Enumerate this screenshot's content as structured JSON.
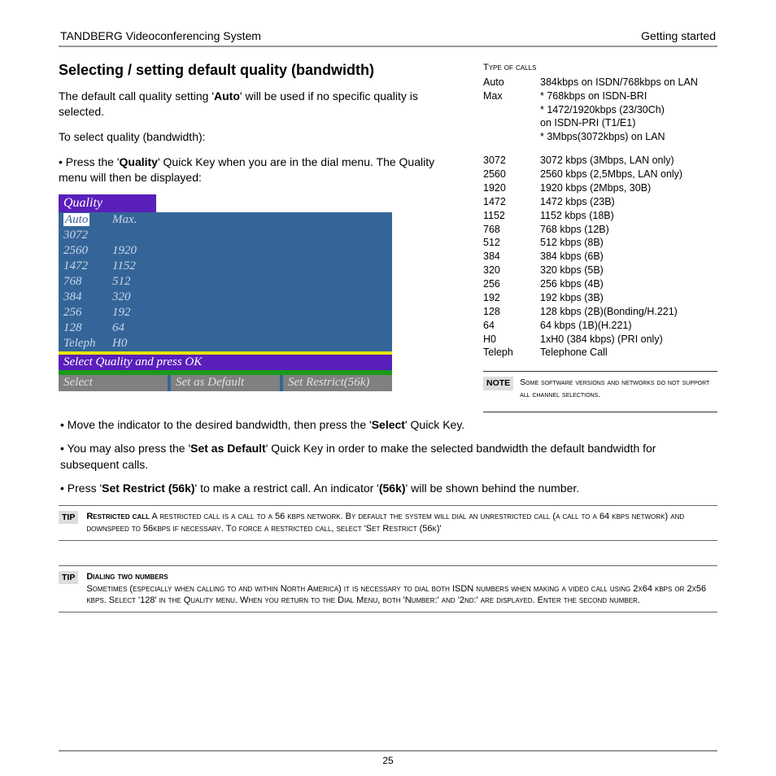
{
  "header": {
    "left": "TANDBERG Videoconferencing System",
    "right": "Getting started"
  },
  "title": "Selecting / setting default quality (bandwidth)",
  "para1a": "The default call quality setting '",
  "para1b": "Auto",
  "para1c": "' will be used if no specific quality is selected.",
  "para2": "To select quality (bandwidth):",
  "para3a": "• Press the '",
  "para3b": "Quality",
  "para3c": "' Quick Key when you are in the dial menu. The Quality menu will then be displayed:",
  "menu": {
    "title": "Quality",
    "rows": [
      [
        "Auto",
        "Max."
      ],
      [
        "3072",
        ""
      ],
      [
        "2560",
        "1920"
      ],
      [
        "1472",
        "1152"
      ],
      [
        "768",
        "512"
      ],
      [
        "384",
        "320"
      ],
      [
        "256",
        "192"
      ],
      [
        "128",
        "64"
      ],
      [
        "Teleph",
        "H0"
      ]
    ],
    "prompt": "Select Quality and press OK",
    "btn1": "Select",
    "btn2": "Set as Default",
    "btn3": "Set Restrict(56k)"
  },
  "calls": {
    "heading": "Type of calls",
    "top": [
      [
        "Auto",
        "384kbps on ISDN/768kbps on LAN"
      ],
      [
        "Max",
        "* 768kbps on ISDN-BRI"
      ],
      [
        "",
        "* 1472/1920kbps (23/30Ch)"
      ],
      [
        "",
        "  on ISDN-PRI (T1/E1)"
      ],
      [
        "",
        "* 3Mbps(3072kbps)  on LAN"
      ]
    ],
    "rows": [
      [
        "3072",
        "3072 kbps (3Mbps, LAN only)"
      ],
      [
        "2560",
        "2560 kbps (2,5Mbps, LAN only)"
      ],
      [
        "1920",
        "1920 kbps (2Mbps, 30B)"
      ],
      [
        "1472",
        "1472 kbps (23B)"
      ],
      [
        "1152",
        "1152 kbps (18B)"
      ],
      [
        "768",
        "768 kbps (12B)"
      ],
      [
        "512",
        "512 kbps (8B)"
      ],
      [
        "384",
        "384 kbps (6B)"
      ],
      [
        "320",
        "320 kbps (5B)"
      ],
      [
        "256",
        "256 kbps (4B)"
      ],
      [
        "192",
        "192 kbps (3B)"
      ],
      [
        "128",
        "128 kbps (2B)(Bonding/H.221)"
      ],
      [
        "64",
        "64 kbps (1B)(H.221)"
      ],
      [
        "H0",
        "1xH0 (384 kbps) (PRI only)"
      ],
      [
        "Teleph",
        "Telephone Call"
      ]
    ]
  },
  "note": {
    "label": "NOTE",
    "text": "Some software versions and networks do not support all channel selections."
  },
  "bullets": {
    "b1a": "• Move the indicator to the desired bandwidth, then press the '",
    "b1b": "Select",
    "b1c": "' Quick Key.",
    "b2a": "• You may also press the '",
    "b2b": "Set as Default",
    "b2c": "' Quick Key in order to make the selected bandwidth the default bandwidth for subsequent calls.",
    "b3a": "• Press '",
    "b3b": "Set Restrict (56k)",
    "b3c": "' to make a restrict call. An indicator '",
    "b3d": "(56k)",
    "b3e": "' will be shown behind the number."
  },
  "tip1": {
    "label": "TIP",
    "heada": "Restricted call",
    "body": " A restricted call is a call to a 56 kbps network. By default the system will dial an unrestricted call (a call to a 64 kbps network) and downspeed to 56kbps if necessary. To force a restricted call, select 'Set Restrict (56k)'"
  },
  "tip2": {
    "label": "TIP",
    "head": "Dialing two numbers",
    "body": "Sometimes (especially when calling to and within North America) it is necessary to dial both ISDN numbers when making a video call using 2x64 kbps or 2x56 kbps. Select '128' in the Quality menu. When you return to the Dial Menu, both 'Number:' and '2nd:' are displayed. Enter the second number."
  },
  "page": "25"
}
